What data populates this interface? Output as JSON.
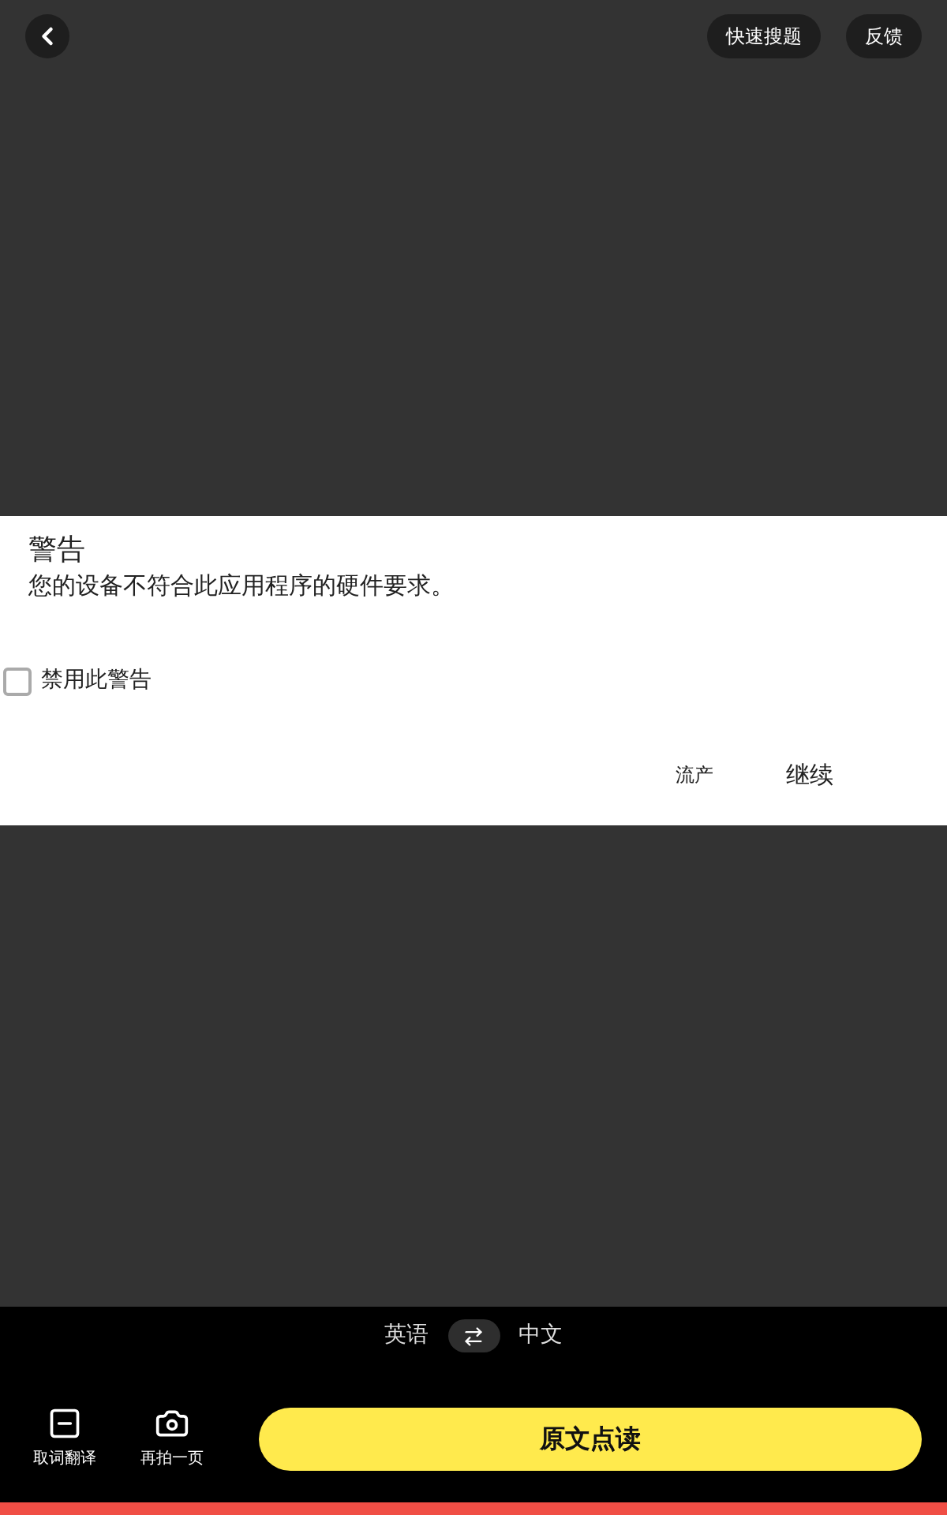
{
  "top_bar": {
    "buttons": [
      "快速搜题",
      "反馈"
    ]
  },
  "dialog": {
    "title": "警告",
    "message": "您的设备不符合此应用程序的硬件要求。",
    "checkbox": {
      "label": "禁用此警告",
      "checked": false
    },
    "buttons": [
      {
        "label": "流产",
        "kind": "secondary"
      },
      {
        "label": "继续",
        "kind": "primary"
      }
    ]
  },
  "language_bar": {
    "source": "英语",
    "target": "中文"
  },
  "bottom_tools": [
    {
      "label": "取词翻译",
      "kind": "select"
    },
    {
      "label": "再拍一页",
      "kind": "camera"
    }
  ],
  "main_button": "原文点读"
}
